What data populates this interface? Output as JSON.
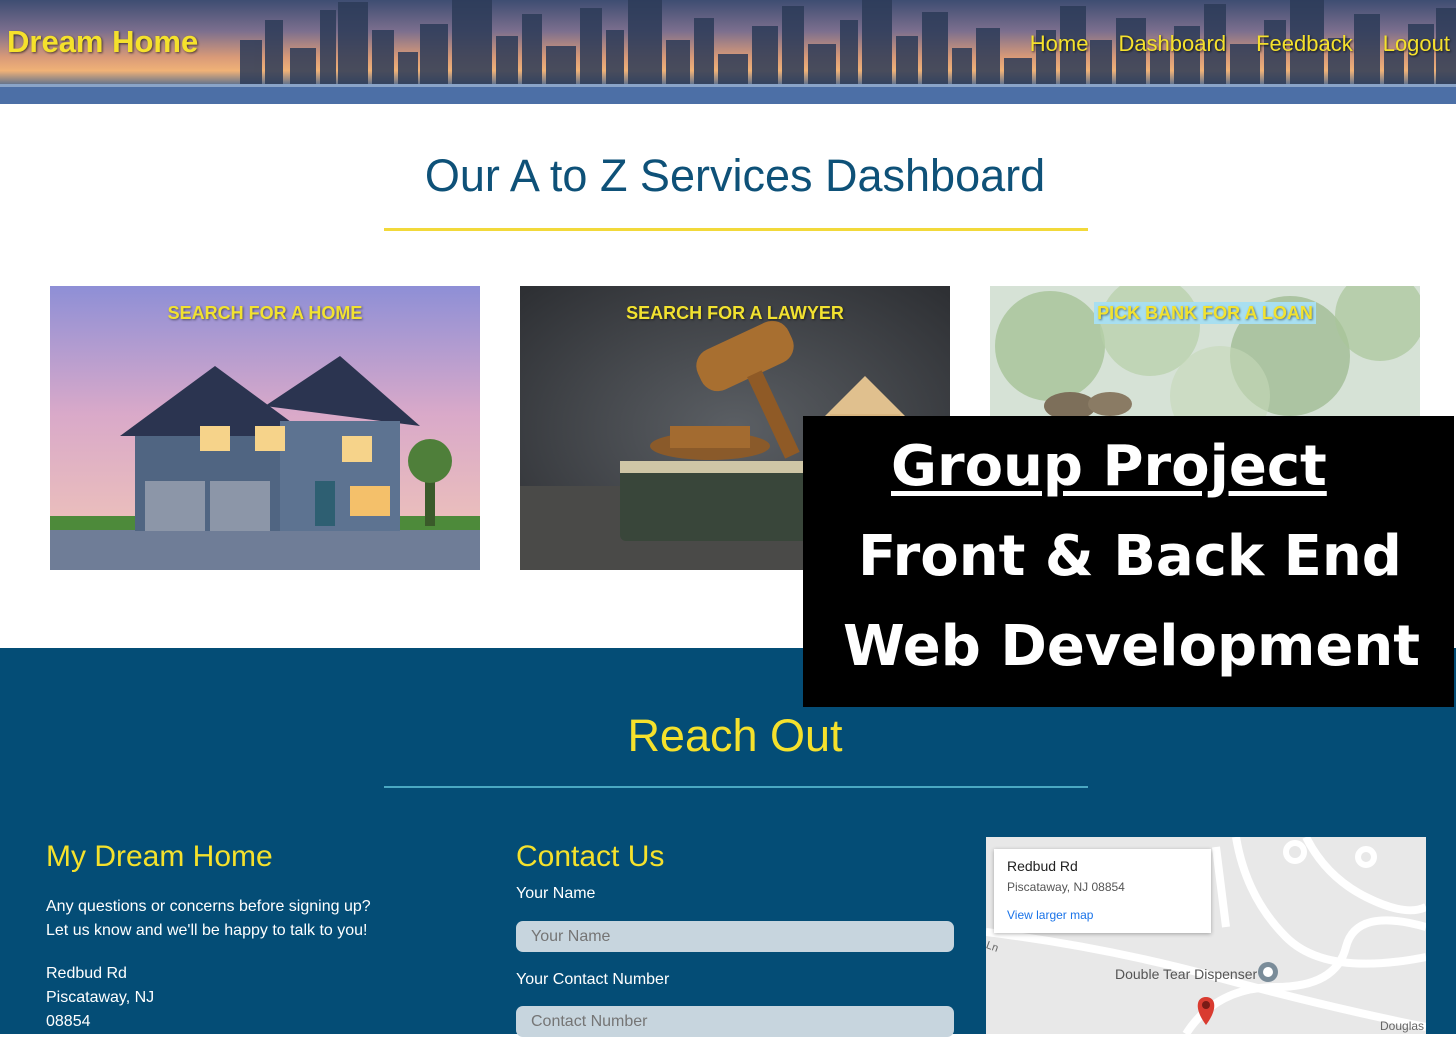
{
  "header": {
    "brand": "Dream Home",
    "nav": [
      {
        "label": "Home"
      },
      {
        "label": "Dashboard"
      },
      {
        "label": "Feedback"
      },
      {
        "label": "Logout"
      }
    ]
  },
  "dashboard": {
    "title": "Our A to Z Services Dashboard",
    "cards": [
      {
        "label": "SEARCH FOR A HOME"
      },
      {
        "label": "SEARCH FOR A LAWYER"
      },
      {
        "label": "PICK BANK FOR A LOAN"
      }
    ]
  },
  "reach": {
    "title": "Reach Out",
    "about": {
      "title": "My Dream Home",
      "line1": "Any questions or concerns before signing up?",
      "line2": "Let us know and we'll be happy to talk to you!",
      "addr1": "Redbud Rd",
      "addr2": "Piscataway, NJ",
      "addr3": "08854"
    },
    "contact": {
      "title": "Contact Us",
      "name_label": "Your Name",
      "name_placeholder": "Your Name",
      "number_label": "Your Contact Number",
      "number_placeholder": "Contact Number"
    },
    "map": {
      "street": "Redbud Rd",
      "city": "Piscataway, NJ 08854",
      "larger_link": "View larger map",
      "poi": "Double Tear Dispenser",
      "road_douglas": "Douglas",
      "road_ln": "Ln"
    }
  },
  "overlay": {
    "line1": "Group Project",
    "line2": "Front & Back End",
    "line3": "Web Development"
  },
  "colors": {
    "accent_yellow": "#f5e12c",
    "footer_blue": "#044d76",
    "title_blue": "#0e5178"
  }
}
